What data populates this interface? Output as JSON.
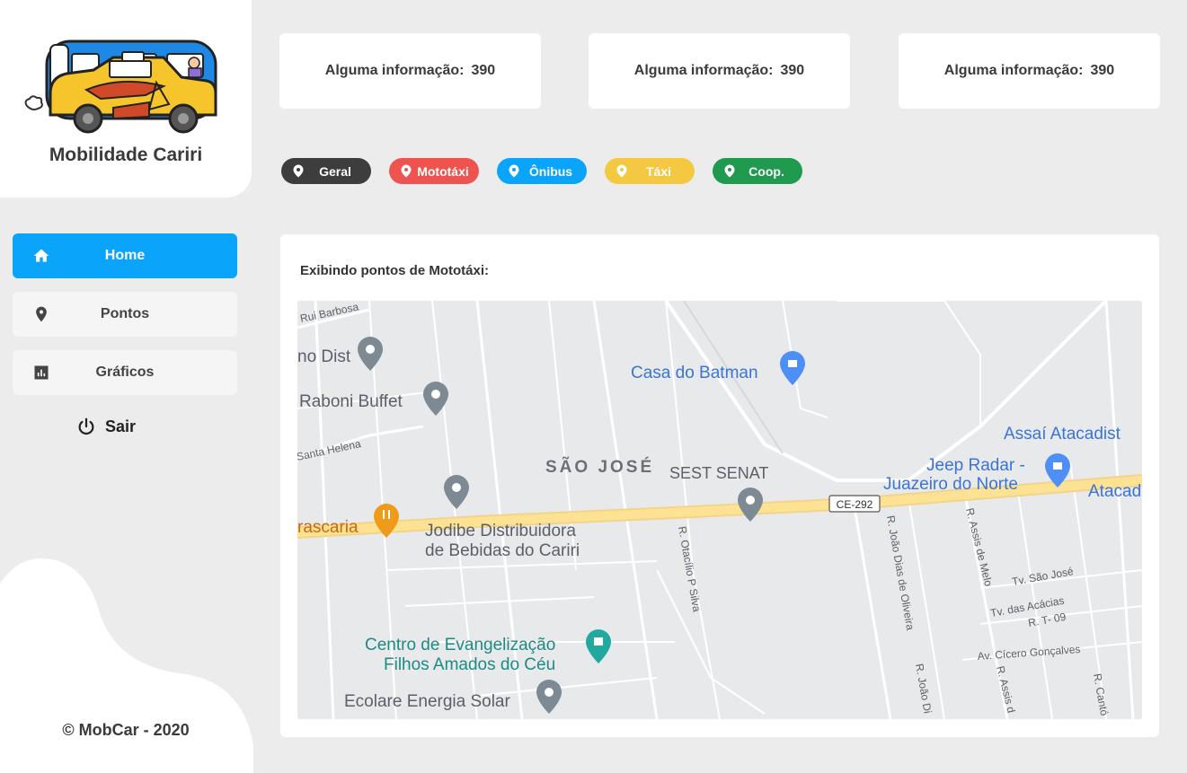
{
  "sidebar": {
    "brand_name": "Mobilidade Cariri",
    "nav": [
      {
        "label": "Home",
        "icon": "home-icon",
        "active": true
      },
      {
        "label": "Pontos",
        "icon": "map-pin-icon",
        "active": false
      },
      {
        "label": "Gráficos",
        "icon": "bar-chart-icon",
        "active": false
      }
    ],
    "logout_label": "Sair",
    "footer": "© MobCar - 2020"
  },
  "cards": [
    {
      "label": "Alguma informação:",
      "value": "390"
    },
    {
      "label": "Alguma informação:",
      "value": "390"
    },
    {
      "label": "Alguma informação:",
      "value": "390"
    }
  ],
  "filters": [
    {
      "label": "Geral",
      "color": "#3d3d3d"
    },
    {
      "label": "Mototáxi",
      "color": "#ef5350"
    },
    {
      "label": "Ônibus",
      "color": "#0aa4fb"
    },
    {
      "label": "Táxi",
      "color": "#f5c842"
    },
    {
      "label": "Coop.",
      "color": "#1f9a4f"
    }
  ],
  "panel": {
    "title": "Exibindo pontos de Mototáxi:"
  },
  "map": {
    "labels": {
      "rui_barbosa": "Rui Barbosa",
      "no_dist": "no Dist",
      "raboni": "Raboni Buffet",
      "santa_helena": "Santa Helena",
      "sao_jose": "SÃO JOSÉ",
      "sest_senat": "SEST SENAT",
      "casa_batman": "Casa do Batman",
      "assai": "Assaí Atacadist",
      "jeep_1": "Jeep Radar -",
      "jeep_2": "Juazeiro do Norte",
      "atacad": "Atacad",
      "ce_292": "CE-292",
      "rascaria": "rascaria",
      "jodibe_1": "Jodibe Distribuidora",
      "jodibe_2": "de Bebidas do Cariri",
      "otacilio": "R. Otacílio P Silva",
      "joao_dias": "R. João Dias de Oliveira",
      "joao_dias2": "R. João Di",
      "assis_melo": "R. Assis de Melo",
      "assis2": "R. Assis d",
      "tv_sao_jose": "Tv. São José",
      "tv_acacias": "Tv. das Acácias",
      "rt09": "R. T- 09",
      "cicero": "Av. Cícero Gonçalves",
      "r_canto": "R. Cantó",
      "evangelizacao_1": "Centro de Evangelização",
      "evangelizacao_2": "Filhos Amados do Céu",
      "ecolare": "Ecolare Energia Solar"
    }
  },
  "colors": {
    "accent": "#0aa4fb",
    "pin_gray": "#7d8a94",
    "pin_blue": "#4e8ef7",
    "pin_orange": "#f09a1a",
    "pin_teal": "#23a8a0",
    "road_major": "#fde293"
  }
}
